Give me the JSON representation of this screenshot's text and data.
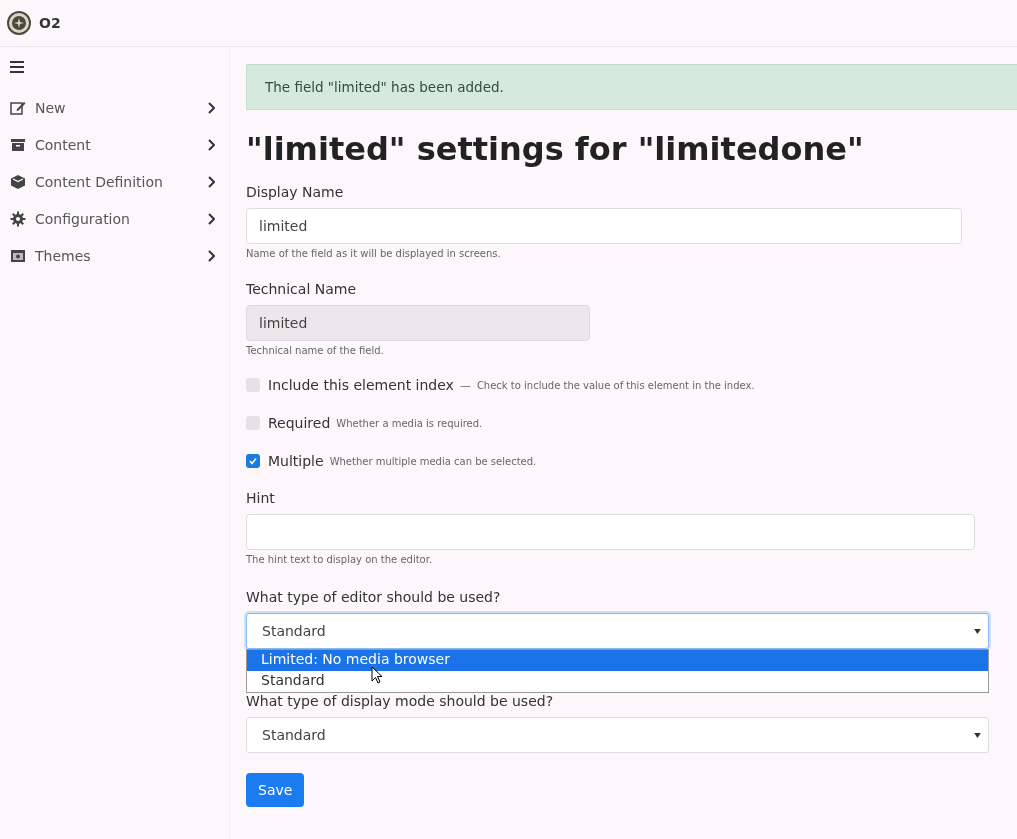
{
  "brand": {
    "name": "O2"
  },
  "sidebar": {
    "items": [
      {
        "label": "New",
        "kind": "new"
      },
      {
        "label": "Content",
        "kind": "content"
      },
      {
        "label": "Content Definition",
        "kind": "definition"
      },
      {
        "label": "Configuration",
        "kind": "configuration"
      },
      {
        "label": "Themes",
        "kind": "themes"
      }
    ]
  },
  "alert": {
    "message": "The field \"limited\" has been added."
  },
  "heading": "\"limited\" settings for \"limitedone\"",
  "display_name": {
    "label": "Display Name",
    "value": "limited",
    "help": "Name of the field as it will be displayed in screens."
  },
  "technical_name": {
    "label": "Technical Name",
    "value": "limited",
    "disabled": true,
    "help": "Technical name of the field."
  },
  "options": [
    {
      "label": "Include this element index",
      "separator": "—",
      "help": "Check to include the value of this element in the index.",
      "checked": false
    },
    {
      "label": "Required",
      "help": "Whether a media is required.",
      "checked": false
    },
    {
      "label": "Multiple",
      "help": "Whether multiple media can be selected.",
      "checked": true
    }
  ],
  "hint": {
    "label": "Hint",
    "help": "The hint text to display on the editor."
  },
  "editor": {
    "label": "What type of editor should be used?",
    "value": "Standard",
    "expanded": true,
    "options": [
      {
        "label": "Limited: No media browser",
        "highlighted": true
      },
      {
        "label": "Standard",
        "highlighted": false
      }
    ]
  },
  "display_mode": {
    "label": "What type of display mode should be used?",
    "value": "Standard"
  },
  "save_button": "Save"
}
